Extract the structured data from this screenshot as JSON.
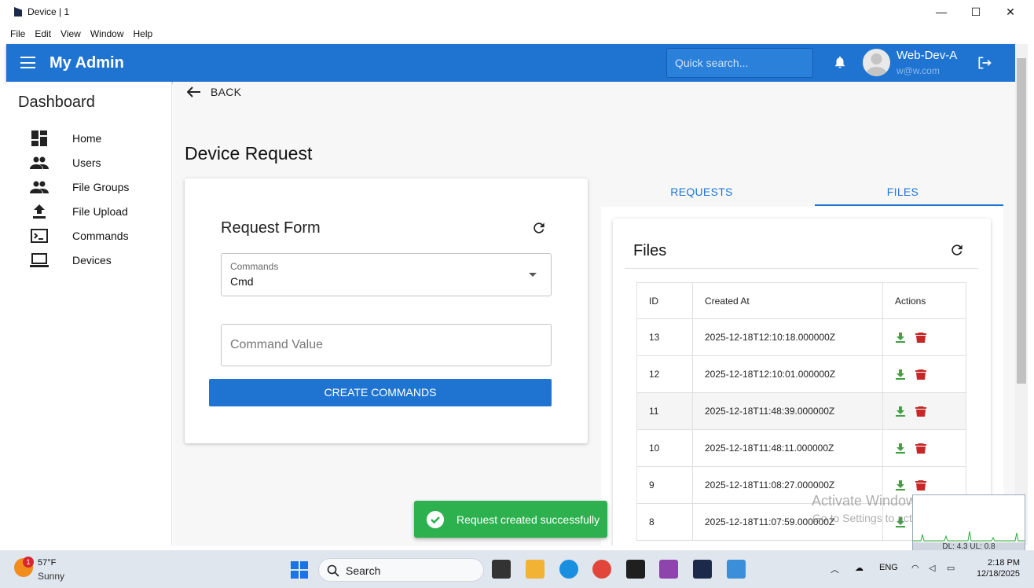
{
  "window": {
    "title": "Device | 1",
    "minimize": "—",
    "maximize": "☐",
    "close": "✕"
  },
  "menubar": [
    "File",
    "Edit",
    "View",
    "Window",
    "Help"
  ],
  "appbar": {
    "brand": "My Admin",
    "search_placeholder": "Quick search...",
    "user_name": "Web-Dev-A",
    "user_email": "w@w.com"
  },
  "sidebar": {
    "title": "Dashboard",
    "items": [
      {
        "label": "Home",
        "icon": "dashboard-icon"
      },
      {
        "label": "Users",
        "icon": "people-icon"
      },
      {
        "label": "File Groups",
        "icon": "people-icon"
      },
      {
        "label": "File Upload",
        "icon": "upload-icon"
      },
      {
        "label": "Commands",
        "icon": "terminal-icon"
      },
      {
        "label": "Devices",
        "icon": "laptop-icon"
      }
    ]
  },
  "page": {
    "back_label": "BACK",
    "title": "Device Request"
  },
  "request_form": {
    "title": "Request Form",
    "commands_label": "Commands",
    "commands_value": "Cmd",
    "command_value_placeholder": "Command Value",
    "create_button": "CREATE COMMANDS"
  },
  "tabs": [
    {
      "label": "REQUESTS",
      "active": false
    },
    {
      "label": "FILES",
      "active": true
    }
  ],
  "files": {
    "title": "Files",
    "columns": [
      "ID",
      "Created At",
      "Actions"
    ],
    "rows": [
      {
        "id": "13",
        "created_at": "2025-12-18T12:10:18.000000Z"
      },
      {
        "id": "12",
        "created_at": "2025-12-18T12:10:01.000000Z"
      },
      {
        "id": "11",
        "created_at": "2025-12-18T11:48:39.000000Z"
      },
      {
        "id": "10",
        "created_at": "2025-12-18T11:48:11.000000Z"
      },
      {
        "id": "9",
        "created_at": "2025-12-18T11:08:27.000000Z"
      },
      {
        "id": "8",
        "created_at": "2025-12-18T11:07:59.000000Z"
      }
    ]
  },
  "toast": {
    "message": "Request created successfully"
  },
  "watermark": {
    "line1": "Activate Windows",
    "line2": "Go to Settings to activate Windows."
  },
  "net_widget": {
    "text": "DL: 4.3 UL: 0.8"
  },
  "taskbar": {
    "weather_badge": "1",
    "temperature": "57°F",
    "weather": "Sunny",
    "search_label": "Search",
    "lang": "ENG",
    "time": "2:18 PM",
    "date": "12/18/2025"
  },
  "colors": {
    "primary": "#1f74d2",
    "success": "#2db14f",
    "download": "#43a047",
    "delete": "#c62828"
  }
}
